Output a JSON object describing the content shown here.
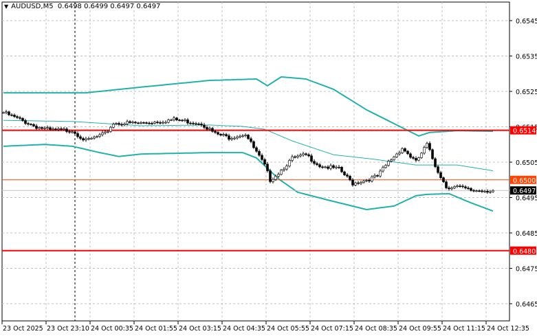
{
  "header": {
    "symbol": "AUDUSD,M5",
    "ohlc": "0.6498 0.6499 0.6497 0.6497"
  },
  "colors": {
    "level_line": "#ff0000",
    "round_level_line": "#ff4500",
    "bands": "#20b2aa",
    "last_price_bg": "#000000",
    "grid": "#c0c0c0"
  },
  "chart_data": {
    "type": "candlestick",
    "symbol": "AUDUSD",
    "timeframe": "M5",
    "ylim": [
      0.646,
      0.655
    ],
    "yticks": [
      "0.6545",
      "0.6535",
      "0.6525",
      "0.6515",
      "0.6505",
      "0.6495",
      "0.6485",
      "0.6475",
      "0.6465"
    ],
    "ytick_values": [
      0.6545,
      0.6535,
      0.6525,
      0.6515,
      0.6505,
      0.6495,
      0.6485,
      0.6475,
      0.6465
    ],
    "xticks": [
      "23 Oct 2025",
      "23 Oct 23:10",
      "24 Oct 00:35",
      "24 Oct 01:55",
      "24 Oct 03:15",
      "24 Oct 04:35",
      "24 Oct 05:55",
      "24 Oct 07:15",
      "24 Oct 08:35",
      "24 Oct 09:55",
      "24 Oct 11:15",
      "24 Oct 12:35"
    ],
    "candles_per_xtick": 16,
    "candle_count": 179,
    "close_path": [
      [
        0,
        0.6519
      ],
      [
        12,
        0.6515
      ],
      [
        17,
        0.6514
      ],
      [
        25,
        0.6514
      ],
      [
        30,
        0.6511
      ],
      [
        37,
        0.6513
      ],
      [
        40,
        0.6516
      ],
      [
        50,
        0.6516
      ],
      [
        62,
        0.6517
      ],
      [
        72,
        0.6516
      ],
      [
        77,
        0.6513
      ],
      [
        82,
        0.6512
      ],
      [
        88,
        0.6513
      ],
      [
        91,
        0.6509
      ],
      [
        95,
        0.6504
      ],
      [
        97,
        0.65
      ],
      [
        100,
        0.6502
      ],
      [
        105,
        0.6506
      ],
      [
        110,
        0.6507
      ],
      [
        115,
        0.6504
      ],
      [
        122,
        0.6503
      ],
      [
        127,
        0.6499
      ],
      [
        132,
        0.65
      ],
      [
        136,
        0.6501
      ],
      [
        140,
        0.6505
      ],
      [
        145,
        0.6509
      ],
      [
        150,
        0.6505
      ],
      [
        154,
        0.651
      ],
      [
        157,
        0.6504
      ],
      [
        161,
        0.6498
      ],
      [
        165,
        0.6498
      ],
      [
        170,
        0.6497
      ],
      [
        175,
        0.6497
      ],
      [
        178,
        0.6497
      ]
    ],
    "bollinger_upper": [
      [
        0,
        0.65246
      ],
      [
        30,
        0.65246
      ],
      [
        50,
        0.65262
      ],
      [
        75,
        0.65281
      ],
      [
        92,
        0.65285
      ],
      [
        96,
        0.65266
      ],
      [
        101,
        0.65291
      ],
      [
        110,
        0.65285
      ],
      [
        120,
        0.65256
      ],
      [
        132,
        0.65198
      ],
      [
        142,
        0.65159
      ],
      [
        151,
        0.65124
      ],
      [
        155,
        0.65134
      ],
      [
        165,
        0.65139
      ],
      [
        180,
        0.65137
      ]
    ],
    "bollinger_middle": [
      [
        0,
        0.65168
      ],
      [
        25,
        0.65165
      ],
      [
        50,
        0.65153
      ],
      [
        75,
        0.65155
      ],
      [
        87,
        0.65151
      ],
      [
        95,
        0.65143
      ],
      [
        105,
        0.6511
      ],
      [
        120,
        0.65071
      ],
      [
        135,
        0.65058
      ],
      [
        150,
        0.65042
      ],
      [
        165,
        0.65042
      ],
      [
        180,
        0.65023
      ]
    ],
    "bollinger_lower": [
      [
        0,
        0.65095
      ],
      [
        15,
        0.651
      ],
      [
        25,
        0.65095
      ],
      [
        35,
        0.65077
      ],
      [
        42,
        0.65066
      ],
      [
        50,
        0.65073
      ],
      [
        75,
        0.65077
      ],
      [
        87,
        0.65077
      ],
      [
        92,
        0.65062
      ],
      [
        100,
        0.65003
      ],
      [
        107,
        0.64965
      ],
      [
        117,
        0.64945
      ],
      [
        132,
        0.64916
      ],
      [
        142,
        0.64926
      ],
      [
        150,
        0.64955
      ],
      [
        154,
        0.64959
      ],
      [
        162,
        0.64961
      ],
      [
        170,
        0.64935
      ],
      [
        180,
        0.64906
      ]
    ],
    "horizontal_levels": [
      {
        "price": 0.6514,
        "label": "0.6514",
        "style": "red-thick"
      },
      {
        "price": 0.65,
        "label": "0.6500",
        "style": "orange-thin"
      },
      {
        "price": 0.648,
        "label": "0.6480",
        "style": "red-thick"
      }
    ],
    "last_price": {
      "price": 0.6497,
      "label": "0.6497"
    },
    "vertical_marker_index": 26
  }
}
